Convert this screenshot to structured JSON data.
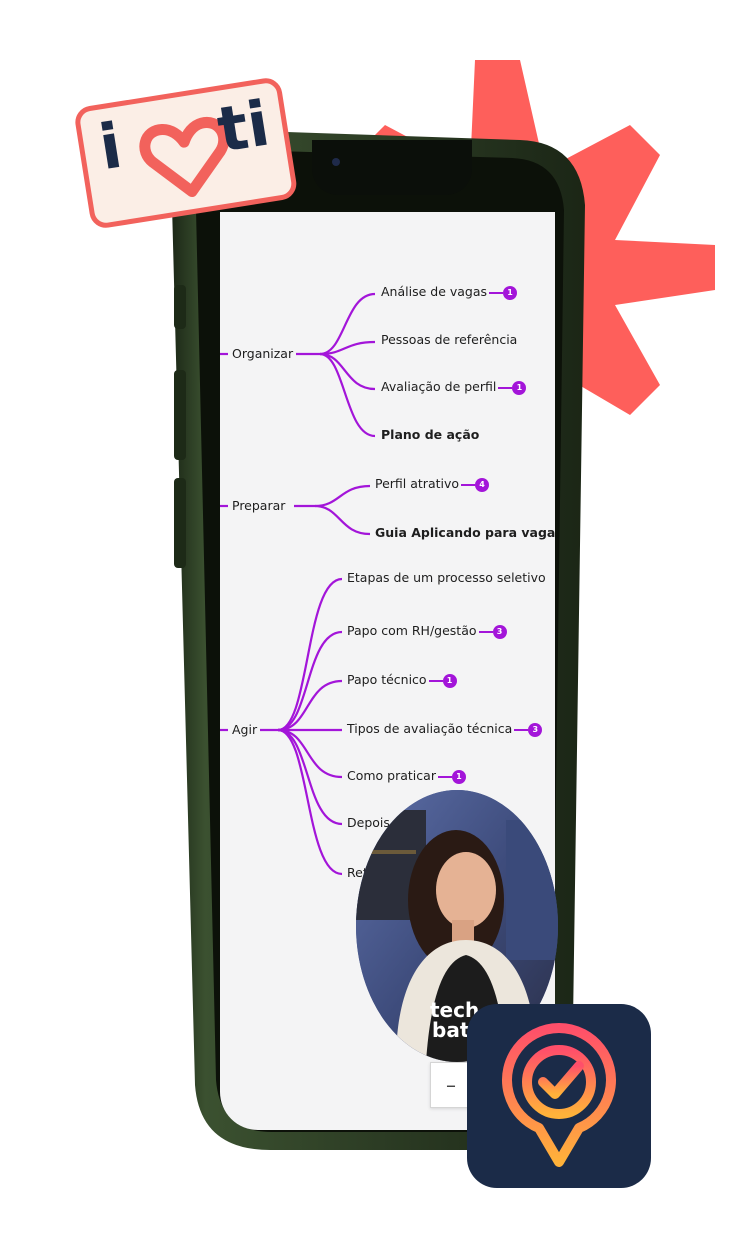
{
  "logo_sticker": {
    "text_i": "i",
    "text_ti": "ti",
    "icon": "heart-icon"
  },
  "mindmap": {
    "groups": [
      {
        "label": "Organizar",
        "items": [
          {
            "label": "Análise de vagas",
            "badge": "1",
            "bold": false
          },
          {
            "label": "Pessoas de referência",
            "badge": null,
            "bold": false
          },
          {
            "label": "Avaliação de perfil",
            "badge": "1",
            "bold": false
          },
          {
            "label": "Plano de ação",
            "badge": null,
            "bold": true
          }
        ]
      },
      {
        "label": "Preparar",
        "items": [
          {
            "label": "Perfil atrativo",
            "badge": "4",
            "bold": false
          },
          {
            "label": "Guia Aplicando para vagas",
            "badge": "",
            "bold": true
          }
        ]
      },
      {
        "label": "Agir",
        "items": [
          {
            "label": "Etapas de um processo seletivo",
            "badge": null,
            "bold": false
          },
          {
            "label": "Papo com RH/gestão",
            "badge": "3",
            "bold": false
          },
          {
            "label": "Papo técnico",
            "badge": "1",
            "bold": false
          },
          {
            "label": "Tipos de avaliação técnica",
            "badge": "3",
            "bold": false
          },
          {
            "label": "Como praticar",
            "badge": "1",
            "bold": false
          },
          {
            "label": "Depois d",
            "badge": null,
            "bold": false
          },
          {
            "label": "Ret",
            "badge": null,
            "bold": false
          }
        ]
      }
    ]
  },
  "zoom_control": {
    "label": "–"
  },
  "video": {
    "shirt_text_1": "tech",
    "shirt_text_2": "bati",
    "icon": "presenter-video"
  },
  "app_icon": {
    "icon": "location-check-icon"
  },
  "colors": {
    "accent": "#a315d9",
    "gear": "#fe5f5b",
    "phone": "#2a3a22",
    "app_bg": "#1b2b48"
  }
}
